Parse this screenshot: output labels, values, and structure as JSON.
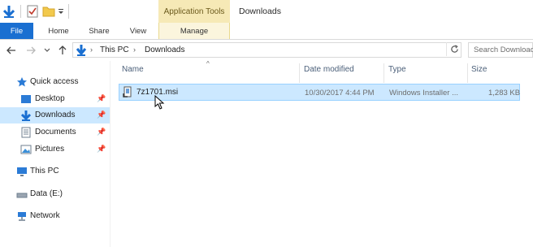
{
  "titlebar": {
    "context_tab": "Application Tools",
    "window_title": "Downloads"
  },
  "ribbon": {
    "tabs": [
      {
        "label": "File"
      },
      {
        "label": "Home"
      },
      {
        "label": "Share"
      },
      {
        "label": "View"
      },
      {
        "label": "Manage"
      }
    ]
  },
  "address": {
    "crumbs": [
      "This PC",
      "Downloads"
    ],
    "search_placeholder": "Search Downloads"
  },
  "nav": {
    "quick_access": "Quick access",
    "items": [
      {
        "label": "Desktop",
        "pinned": true
      },
      {
        "label": "Downloads",
        "pinned": true,
        "selected": true
      },
      {
        "label": "Documents",
        "pinned": true
      },
      {
        "label": "Pictures",
        "pinned": true
      }
    ],
    "this_pc": "This PC",
    "drive": "Data (E:)",
    "network": "Network"
  },
  "list": {
    "columns": [
      "Name",
      "Date modified",
      "Type",
      "Size"
    ],
    "rows": [
      {
        "name": "7z1701.msi",
        "date": "10/30/2017 4:44 PM",
        "type": "Windows Installer ...",
        "size": "1,283 KB",
        "selected": true
      }
    ]
  },
  "colors": {
    "file_tab": "#1a6fd1",
    "context_tab": "#f6e9b6",
    "selection": "#cce8ff",
    "selection_border": "#99d1ff"
  }
}
